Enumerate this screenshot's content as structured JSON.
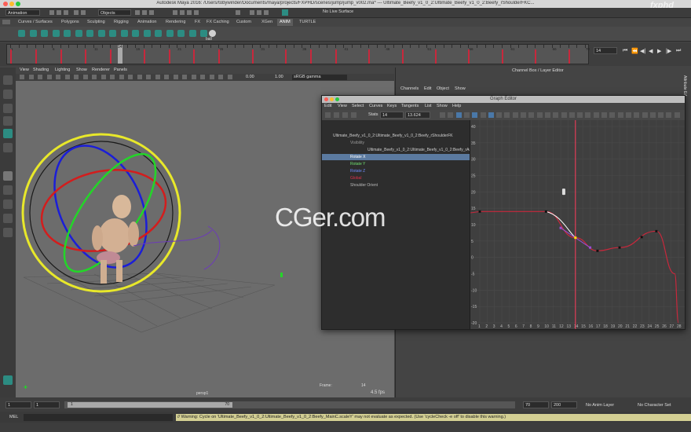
{
  "window": {
    "title": "Autodesk Maya 2016: /Users/tobywinder/Documents/maya/projects/FXPHD/scenes/jump/jump_v002.ma* --- Ultimate_Beefy_v1_0_2:Ultimate_Beefy_v1_0_2:Beefy_rShoulderFKC...",
    "logo": "fxphd"
  },
  "status_line": {
    "menu_set": "Animation",
    "objects_label": "Objects",
    "live_surface": "No Live Surface"
  },
  "shelf": {
    "tabs": [
      "Curves / Surfaces",
      "Polygons",
      "Sculpting",
      "Rigging",
      "Animation",
      "Rendering",
      "FX",
      "FX Caching",
      "Custom",
      "XGen",
      "ANIM",
      "TURTLE"
    ],
    "active_tab": "ANIM",
    "ball_label": "ball"
  },
  "timeline": {
    "ticks": [
      "1",
      "2",
      "3",
      "4",
      "5",
      "6",
      "7",
      "8",
      "9",
      "10",
      "11",
      "12",
      "13",
      "14",
      "15",
      "16",
      "17",
      "18",
      "19",
      "20",
      "21",
      "22",
      "23",
      "24",
      "25",
      "26",
      "27",
      "28",
      "29",
      "30",
      "31",
      "32",
      "33",
      "34",
      "35",
      "36",
      "37",
      "38",
      "39",
      "40",
      "41",
      "42",
      "43",
      "44",
      "45",
      "46",
      "47",
      "48",
      "49",
      "50",
      "51",
      "52",
      "53",
      "54",
      "55",
      "56",
      "57",
      "58",
      "59",
      "60",
      "61",
      "62",
      "63",
      "64",
      "65",
      "66",
      "67",
      "68",
      "69",
      "70"
    ],
    "current_frame": "14",
    "current_marker": "14"
  },
  "viewport": {
    "menu": [
      "View",
      "Shading",
      "Lighting",
      "Show",
      "Renderer",
      "Panels"
    ],
    "field_a": "0.00",
    "field_b": "1.00",
    "color_space": "sRGB gamma",
    "camera": "persp1",
    "frame_label": "Frame:",
    "frame_value": "14",
    "fps": "4.5 fps"
  },
  "channel_box": {
    "title": "Channel Box / Layer Editor",
    "menu": [
      "Channels",
      "Edit",
      "Object",
      "Show"
    ],
    "side_label": "Attribute Ed"
  },
  "graph_editor": {
    "title": "Graph Editor",
    "menu": [
      "Edit",
      "View",
      "Select",
      "Curves",
      "Keys",
      "Tangents",
      "List",
      "Show",
      "Help"
    ],
    "stats_label": "Stats",
    "stats_frame": "14",
    "stats_value": "13.624",
    "outliner": [
      {
        "text": "Ultimate_Beefy_v1_0_2:Ultimate_Beefy_v1_0_2:Beefy_rShoulderFK",
        "indent": 0,
        "color": "#cfcfcf",
        "selected": false
      },
      {
        "text": "Visibility",
        "indent": 1,
        "color": "#9a9a9a",
        "selected": false
      },
      {
        "text": "Ultimate_Beefy_v1_0_2:Ultimate_Beefy_v1_0_2:Beefy_rArmCl",
        "indent": 2,
        "color": "#cfcfcf",
        "selected": false
      },
      {
        "text": "Rotate X",
        "indent": 1,
        "color": "#ff6e6e",
        "selected": true
      },
      {
        "text": "Rotate Y",
        "indent": 1,
        "color": "#6fe06f",
        "selected": false
      },
      {
        "text": "Rotate Z",
        "indent": 1,
        "color": "#6f8cff",
        "selected": false
      },
      {
        "text": "Global",
        "indent": 1,
        "color": "#e0304b",
        "selected": false
      },
      {
        "text": "Shoulder Orient",
        "indent": 1,
        "color": "#bbbbbb",
        "selected": false
      }
    ],
    "y_ticks": [
      "40",
      "35",
      "30",
      "25",
      "20",
      "15",
      "10",
      "5",
      "0",
      "-5",
      "-10",
      "-15",
      "-20"
    ],
    "x_ticks": [
      "1",
      "2",
      "3",
      "4",
      "5",
      "6",
      "7",
      "8",
      "9",
      "10",
      "11",
      "12",
      "13",
      "14",
      "15",
      "16",
      "17",
      "18",
      "19",
      "20",
      "21",
      "22",
      "23",
      "24",
      "25",
      "26",
      "27",
      "28"
    ],
    "current_frame": "14",
    "curve": {
      "frames": [
        1,
        10,
        14,
        17,
        20,
        25,
        27.5,
        28
      ],
      "values": [
        14,
        14,
        6,
        2,
        3,
        8,
        -5,
        -20
      ]
    }
  },
  "range_slider": {
    "start_a": "1",
    "start_b": "1",
    "inner_start": "1",
    "inner_end": "70",
    "end_a": "70",
    "end_b": "200",
    "anim_layer": "No Anim Layer",
    "char_set": "No Character Set"
  },
  "command_line": {
    "label": "MEL",
    "warning": "// Warning: Cycle on 'Ultimate_Beefy_v1_0_2:Ultimate_Beefy_v1_0_2:Beefy_MainC.scaleY' may not evaluate as expected.  (Use 'cycleCheck -e off' to disable this warning.)"
  },
  "watermark": "CGer.com",
  "colors": {
    "accent": "#2c8c82",
    "timeline_key": "#c8283c",
    "current_frame": "#ff3b5c",
    "warning_bg": "#d3cf93"
  }
}
